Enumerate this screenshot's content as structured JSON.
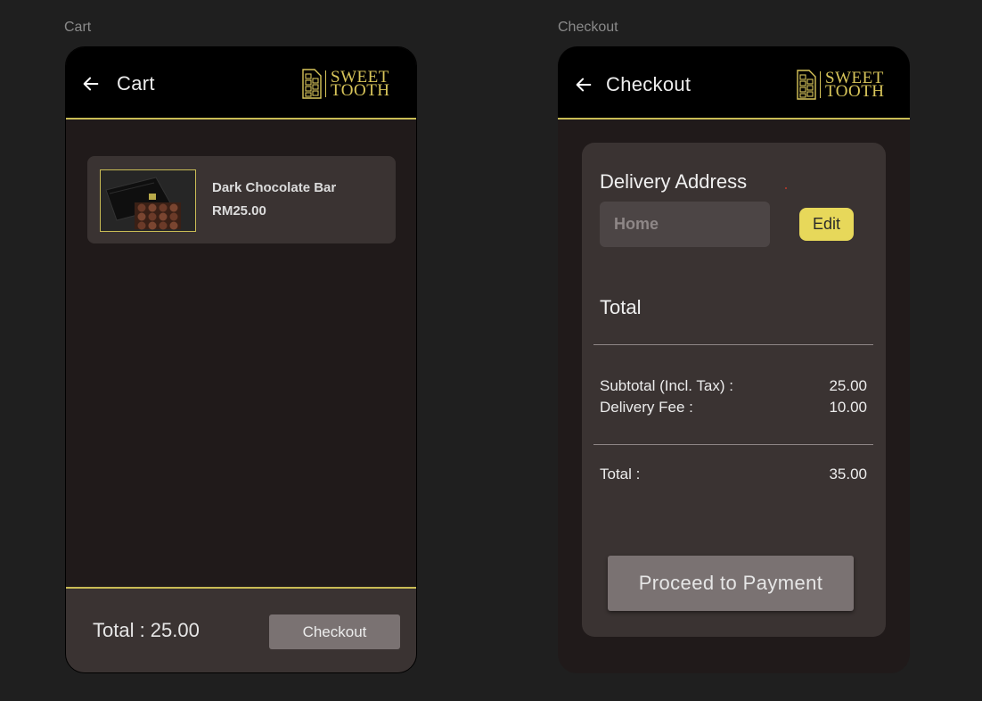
{
  "frames": {
    "cart_label": "Cart",
    "checkout_label": "Checkout"
  },
  "brand": {
    "line1": "SWEET",
    "line2": "TOOTH",
    "accent_color": "#c9bc55",
    "button_yellow": "#e7d85a"
  },
  "cart": {
    "title": "Cart",
    "items": [
      {
        "name": "Dark Chocolate Bar",
        "price": "RM25.00"
      }
    ],
    "footer_total": "Total : 25.00",
    "checkout_label": "Checkout"
  },
  "checkout": {
    "title": "Checkout",
    "delivery_title": "Delivery Address",
    "address_placeholder": "Home",
    "edit_label": "Edit",
    "total_title": "Total",
    "rows": [
      {
        "label": "Subtotal (Incl. Tax) :",
        "value": "25.00"
      },
      {
        "label": "Delivery Fee :",
        "value": "10.00"
      }
    ],
    "grand_total": {
      "label": "Total :",
      "value": "35.00"
    },
    "pay_label": "Proceed to Payment"
  }
}
